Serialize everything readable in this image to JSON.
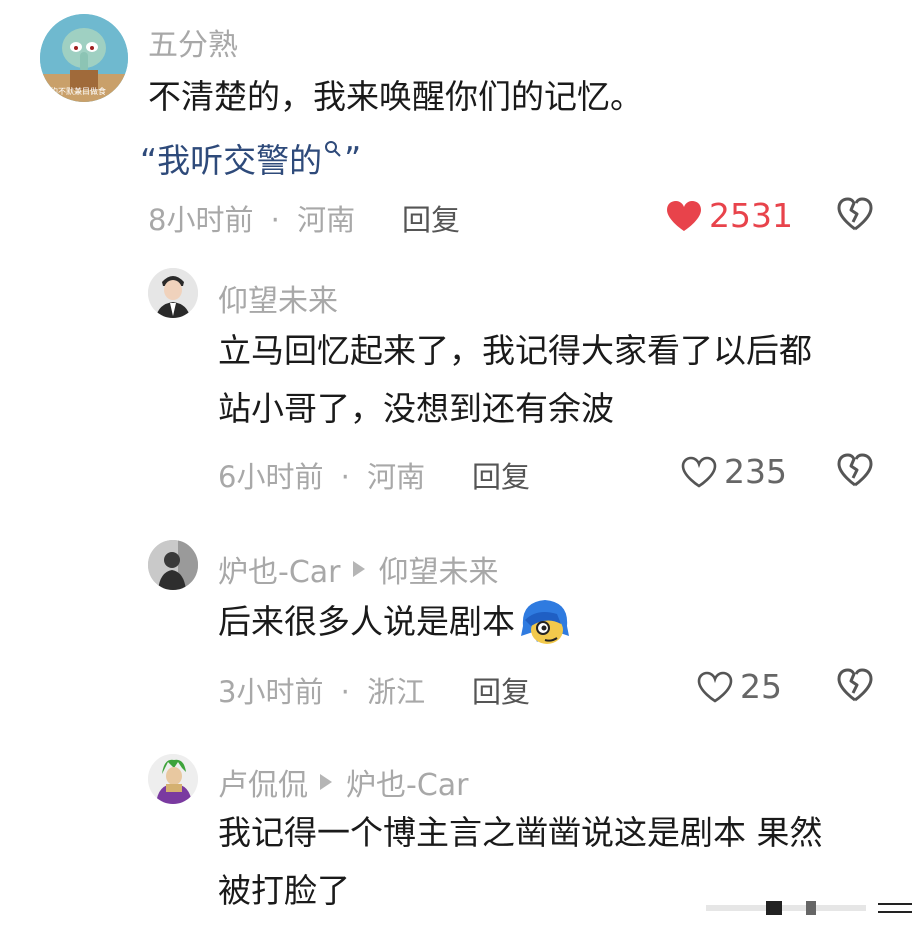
{
  "comments": [
    {
      "username": "五分熟",
      "text_lines": [
        "不清楚的，我来唤醒你们的记忆。"
      ],
      "quote": "“我听交警的",
      "quote_end": "”",
      "time": "8小时前",
      "location": "河南",
      "reply_label": "回复",
      "likes": "2531",
      "liked": true,
      "avatar_icon": "squidward-avatar",
      "avatar_caption": "我约不默兼目做食"
    },
    {
      "username": "仰望未来",
      "text_lines": [
        "立马回忆起来了，我记得大家看了以后都",
        "站小哥了，没想到还有余波"
      ],
      "time": "6小时前",
      "location": "河南",
      "reply_label": "回复",
      "likes": "235",
      "liked": false,
      "avatar_icon": "man-in-suit-avatar"
    },
    {
      "username": "炉也-Car",
      "reply_to": "仰望未来",
      "text_lines": [
        "后来很多人说是剧本"
      ],
      "text_emoji": "blue-hair-face-emoji",
      "time": "3小时前",
      "location": "浙江",
      "reply_label": "回复",
      "likes": "25",
      "liked": false,
      "avatar_icon": "person-photo-avatar"
    },
    {
      "username": "卢侃侃",
      "reply_to": "炉也-Car",
      "text_lines": [
        "我记得一个博主言之凿凿说这是剧本 果然",
        "被打脸了"
      ],
      "avatar_icon": "broly-avatar"
    }
  ],
  "colors": {
    "like_red": "#e8434b",
    "quote_blue": "#2e4a7a",
    "meta_gray": "#a8a8a8"
  },
  "separator": "·"
}
